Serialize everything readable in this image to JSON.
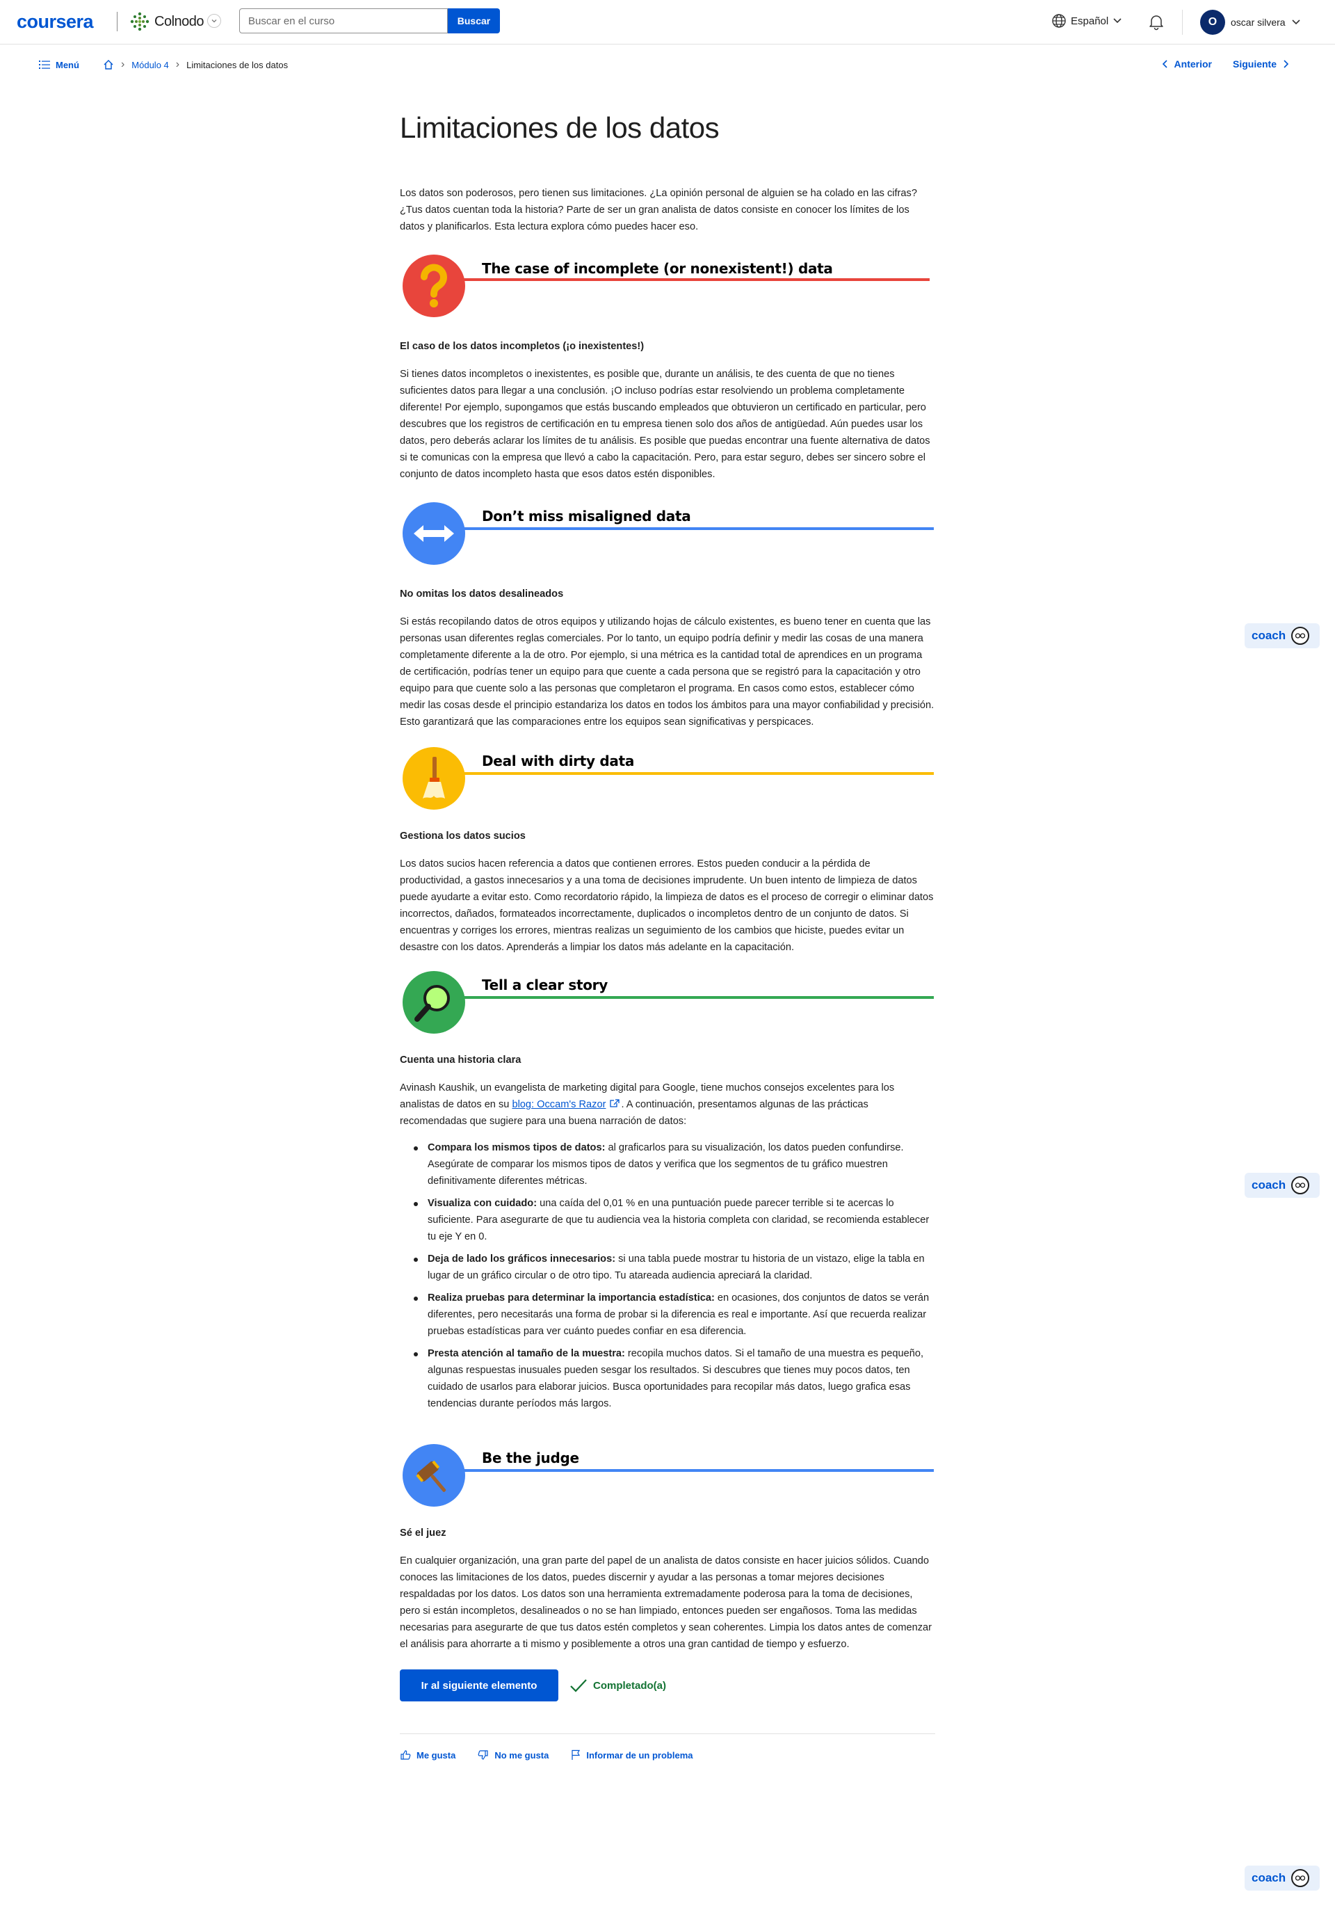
{
  "header": {
    "logo": "coursera",
    "partner": "Colnodo",
    "search": {
      "placeholder": "Buscar en el curso",
      "button": "Buscar"
    },
    "language": "Español",
    "user": {
      "initial": "O",
      "name": "oscar silvera"
    }
  },
  "breadcrumb": {
    "menu": "Menú",
    "module": "Módulo 4",
    "current": "Limitaciones de los datos",
    "prev": "Anterior",
    "next": "Siguiente"
  },
  "article": {
    "title": "Limitaciones de los datos",
    "intro": "Los datos son poderosos, pero tienen sus limitaciones. ¿La opinión personal de alguien se ha colado en las cifras? ¿Tus datos cuentan toda la historia? Parte de ser un gran analista de datos consiste en conocer los límites de los datos y planificarlos. Esta lectura explora cómo puedes hacer eso.",
    "sections": [
      {
        "banner": "The case of incomplete (or nonexistent!) data",
        "color": "#e8453c",
        "icon": "question-mark-icon",
        "heading": "El caso de los datos incompletos (¡o inexistentes!)",
        "text": "Si tienes datos incompletos o inexistentes, es posible que, durante un análisis, te des cuenta de que no tienes suficientes datos para llegar a una conclusión. ¡O incluso podrías estar resolviendo un problema completamente diferente! Por ejemplo, supongamos que estás buscando empleados que obtuvieron un certificado en particular, pero descubres que los registros de certificación en tu empresa tienen solo dos años de antigüedad. Aún puedes usar los datos, pero deberás aclarar los límites de tu análisis. Es posible que puedas encontrar una fuente alternativa de datos si te comunicas con la empresa que llevó a cabo la capacitación. Pero, para estar seguro, debes ser sincero sobre el conjunto de datos incompleto hasta que esos datos estén disponibles."
      },
      {
        "banner": "Don’t miss misaligned data",
        "color": "#4285f4",
        "icon": "double-arrow-icon",
        "heading": "No omitas los datos desalineados",
        "text": "Si estás recopilando datos de otros equipos y utilizando hojas de cálculo existentes, es bueno tener en cuenta que las personas usan diferentes reglas comerciales. Por lo tanto, un equipo podría definir y medir las cosas de una manera completamente diferente a la de otro. Por ejemplo, si una métrica es la cantidad total de aprendices en un programa de certificación, podrías tener un equipo para que cuente a cada persona que se registró para la capacitación y otro equipo para que cuente solo a las personas que completaron el programa. En casos como estos, establecer cómo medir las cosas desde el principio estandariza los datos en todos los ámbitos para una mayor confiabilidad y precisión. Esto garantizará que las comparaciones entre los equipos sean significativas y perspicaces."
      },
      {
        "banner": "Deal with dirty data",
        "color": "#fbbc04",
        "icon": "broom-icon",
        "heading": "Gestiona los datos sucios",
        "text": "Los datos sucios hacen referencia a datos que contienen errores. Estos pueden conducir a la pérdida de productividad, a gastos innecesarios y a una toma de decisiones imprudente. Un buen intento de limpieza de datos puede ayudarte a evitar esto. Como recordatorio rápido, la limpieza de datos es el proceso de corregir o eliminar datos incorrectos, dañados, formateados incorrectamente, duplicados o incompletos dentro de un conjunto de datos. Si encuentras y corriges los errores, mientras realizas un seguimiento de los cambios que hiciste, puedes evitar un desastre con los datos. Aprenderás a limpiar los datos más adelante en la capacitación."
      },
      {
        "banner": "Tell a clear story",
        "color": "#34a853",
        "icon": "magnifier-icon",
        "heading": "Cuenta una historia clara",
        "text_before_link": "Avinash Kaushik, un evangelista de marketing digital para Google, tiene muchos consejos excelentes para los analistas de datos en su ",
        "link": "blog: Occam's Razor",
        "text_after_link": ". A continuación, presentamos algunas de las prácticas recomendadas que sugiere para una buena narración de datos:",
        "tips": [
          {
            "label": "Compara los mismos tipos de datos:",
            "text": " al graficarlos para su visualización, los datos pueden confundirse. Asegúrate de comparar los mismos tipos de datos y verifica que los segmentos de tu gráfico muestren definitivamente diferentes métricas."
          },
          {
            "label": "Visualiza con cuidado:",
            "text": " una caída del 0,01 % en una puntuación puede parecer terrible si te acercas lo suficiente. Para asegurarte de que tu audiencia vea la historia completa con claridad, se recomienda establecer tu eje Y en 0."
          },
          {
            "label": "Deja de lado los gráficos innecesarios:",
            "text": " si una tabla puede mostrar tu historia de un vistazo, elige la tabla en lugar de un gráfico circular o de otro tipo. Tu atareada audiencia apreciará la claridad."
          },
          {
            "label": "Realiza pruebas para determinar la importancia estadística:",
            "text": " en ocasiones, dos conjuntos de datos se verán diferentes, pero necesitarás una forma de probar si la diferencia es real e importante. Así que recuerda realizar pruebas estadísticas para ver cuánto puedes confiar en esa diferencia."
          },
          {
            "label": "Presta atención al tamaño de la muestra:",
            "text": " recopila muchos datos. Si el tamaño de una muestra es pequeño, algunas respuestas inusuales pueden sesgar los resultados. Si descubres que tienes muy pocos datos, ten cuidado de usarlos para elaborar juicios. Busca oportunidades para recopilar más datos, luego grafica esas tendencias durante períodos más largos."
          }
        ]
      },
      {
        "banner": "Be the judge",
        "color": "#4285f4",
        "icon": "gavel-icon",
        "heading": "Sé el juez",
        "text": "En cualquier organización, una gran parte del papel de un analista de datos consiste en hacer juicios sólidos. Cuando conoces las limitaciones de los datos, puedes discernir y ayudar a las personas a tomar mejores decisiones respaldadas por los datos. Los datos son una herramienta extremadamente poderosa para la toma de decisiones, pero si están incompletos, desalineados o no se han limpiado, entonces pueden ser engañosos. Toma las medidas necesarias para asegurarte de que tus datos estén completos y sean coherentes. Limpia los datos antes de comenzar el análisis para ahorrarte a ti mismo y posiblemente a otros una gran cantidad de tiempo y esfuerzo."
      }
    ],
    "next_button": "Ir al siguiente elemento",
    "completed": "Completado(a)",
    "feedback": {
      "like": "Me gusta",
      "dislike": "No me gusta",
      "report": "Informar de un problema"
    }
  },
  "coach": {
    "label": "coach"
  }
}
